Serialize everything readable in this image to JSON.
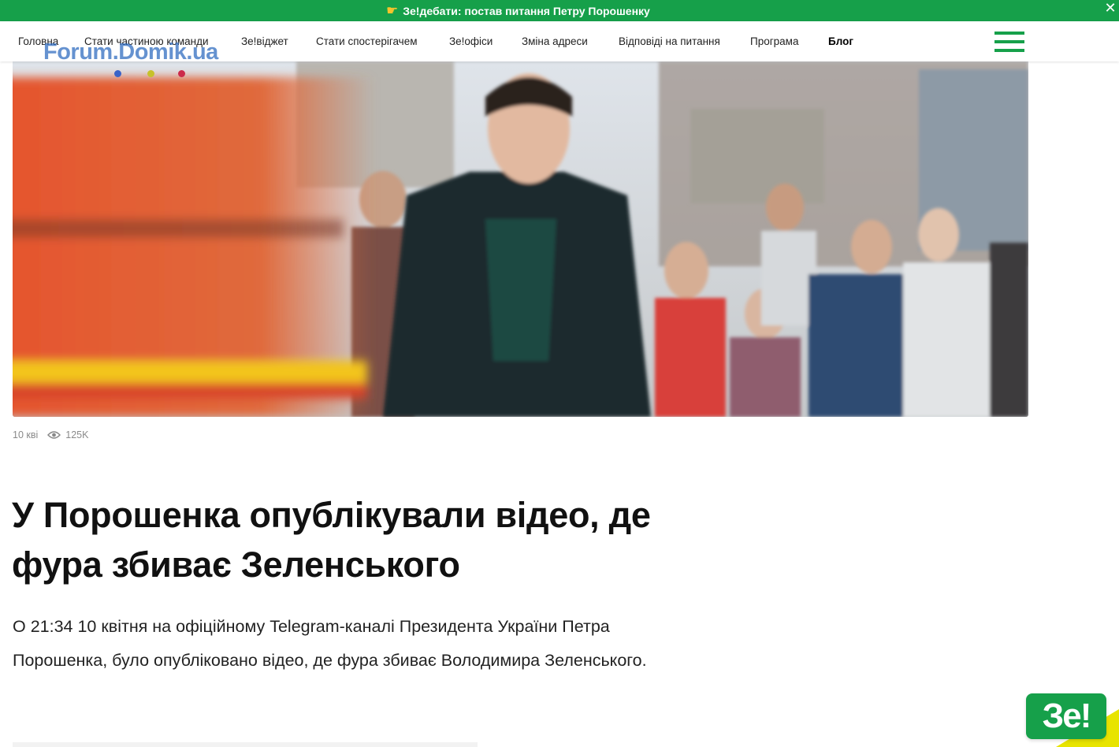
{
  "banner": {
    "text": "Зе!дебати: постав питання Петру Порошенку",
    "hand_icon": "pointing-hand-icon",
    "close_label": "✕",
    "bg_color": "#16a04a"
  },
  "nav": {
    "items": [
      {
        "label": "Головна"
      },
      {
        "label": "Стати частиною команди"
      },
      {
        "label": "Зе!віджет"
      },
      {
        "label": "Стати спостерігачем"
      },
      {
        "label": "Зе!офіси"
      },
      {
        "label": "Зміна адреси"
      },
      {
        "label": "Відповіді на питання"
      },
      {
        "label": "Програма"
      },
      {
        "label": "Блог"
      }
    ],
    "active": "Блог",
    "menu_icon": "hamburger-menu-icon"
  },
  "watermark": {
    "text": "Forum.Domik.ua"
  },
  "article": {
    "date": "10 кві",
    "views": "125K",
    "title": "У Порошенка опублікували відео, де фура збиває Зеленського",
    "lead": "О 21:34 10 квітня на офіційному Telegram-каналі Президента України Петра Порошенка, було опубліковано відео, де фура збиває Володимира Зеленського."
  },
  "badge": {
    "label": "Зе!"
  },
  "colors": {
    "accent": "#16a04a",
    "yellow": "#e8e400"
  }
}
